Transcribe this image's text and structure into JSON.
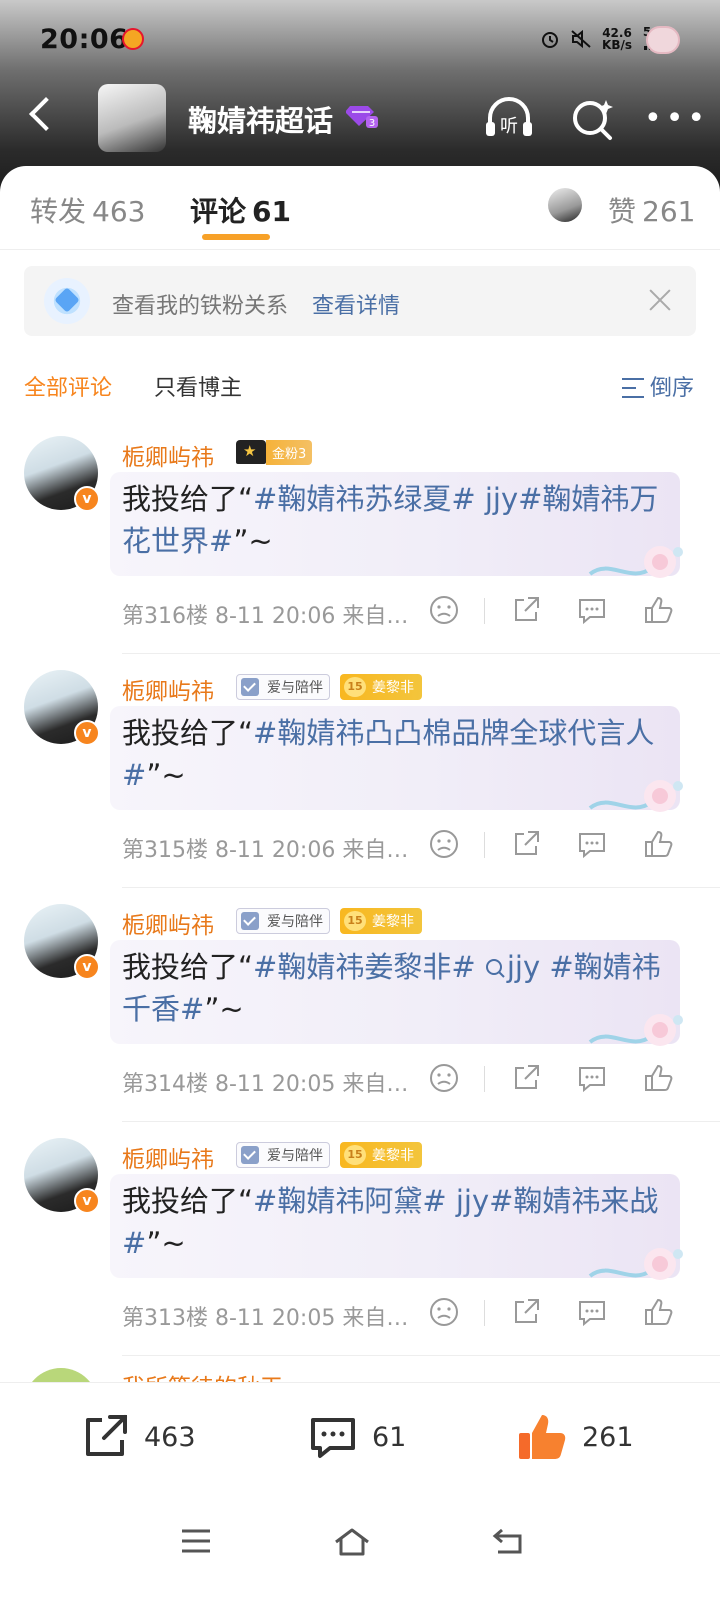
{
  "status_bar": {
    "time": "20:06",
    "net_speed": "42.6",
    "net_unit": "KB/s",
    "signal_label": "5G"
  },
  "header": {
    "title": "鞠婧祎超话"
  },
  "tabs": {
    "forward_label": "转发",
    "forward_count": "463",
    "comment_label": "评论",
    "comment_count": "61",
    "like_label": "赞",
    "like_count": "261"
  },
  "fan_banner": {
    "text": "查看我的铁粉关系",
    "link": "查看详情"
  },
  "filters": {
    "all": "全部评论",
    "blogger_only": "只看博主",
    "sort": "倒序"
  },
  "comments": [
    {
      "user": "栀卿屿祎",
      "badge_gold": "金粉3",
      "text_prefix": "我投给了“",
      "tag": "#鞠婧祎苏绿夏# jjy#鞠婧祎万花世界#",
      "text_suffix": "”~",
      "floor": "第316楼",
      "time": "8-11 20:06",
      "source": "来自…"
    },
    {
      "user": "栀卿屿祎",
      "badge_love": "爱与陪伴",
      "badge_star_level": "15",
      "badge_star": "姜黎非",
      "text_prefix": "我投给了“",
      "tag": "#鞠婧祎凸凸棉品牌全球代言人#",
      "text_suffix": "”~",
      "floor": "第315楼",
      "time": "8-11 20:06",
      "source": "来自…"
    },
    {
      "user": "栀卿屿祎",
      "badge_love": "爱与陪伴",
      "badge_star_level": "15",
      "badge_star": "姜黎非",
      "text_prefix": "我投给了“",
      "tag": "#鞠婧祎姜黎非# ",
      "search_tag": "jjy #鞠婧祎千香#",
      "text_suffix": "”~",
      "floor": "第314楼",
      "time": "8-11 20:05",
      "source": "来自…"
    },
    {
      "user": "栀卿屿祎",
      "badge_love": "爱与陪伴",
      "badge_star_level": "15",
      "badge_star": "姜黎非",
      "text_prefix": "我投给了“",
      "tag": "#鞠婧祎阿黛# jjy#鞠婧祎来战#",
      "text_suffix": "”~",
      "floor": "第313楼",
      "time": "8-11 20:05",
      "source": "来自…"
    }
  ],
  "peek_user": "我所等待的秋天",
  "bottom_bar": {
    "share_count": "463",
    "comment_count": "61",
    "like_count": "261"
  },
  "colors": {
    "accent_orange": "#f7851e",
    "link_blue": "#4a6fa5",
    "tab_underline": "#f7a128"
  }
}
